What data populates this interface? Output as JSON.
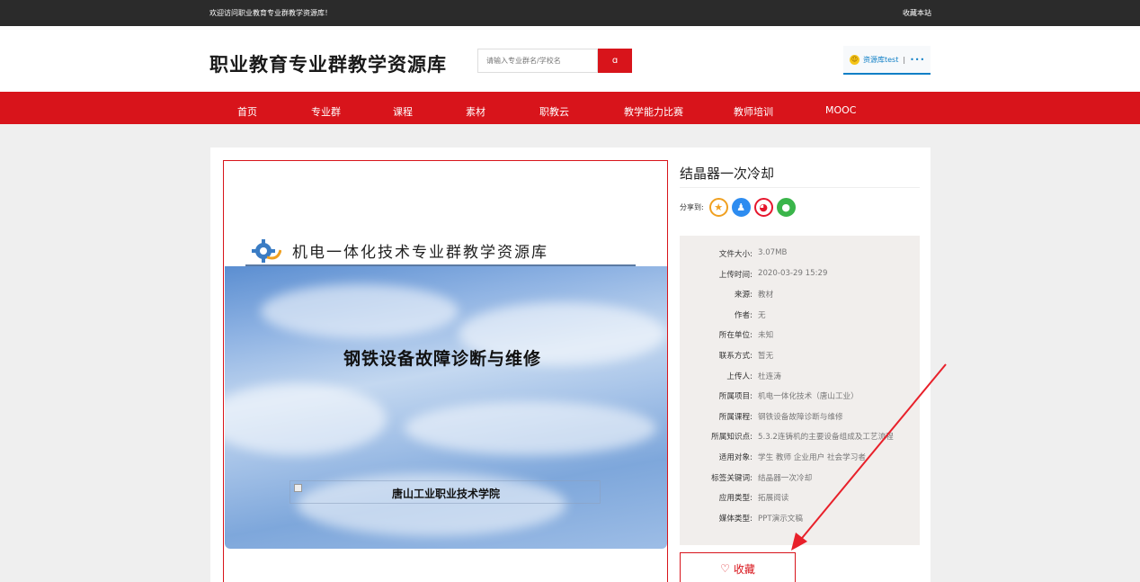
{
  "topbar": {
    "welcome": "欢迎访问职业教育专业群教学资源库！",
    "favorite": "收藏本站"
  },
  "header": {
    "logo": "职业教育专业群教学资源库",
    "search_placeholder": "请输入专业群名/学校名",
    "search_icon": "search-icon",
    "user_name": "资源库test",
    "user_sep": "|",
    "user_more": "•••"
  },
  "nav": {
    "items": [
      "首页",
      "专业群",
      "课程",
      "素材",
      "职教云",
      "教学能力比赛",
      "教师培训",
      "MOOC"
    ]
  },
  "preview": {
    "slide_title": "机电一体化技术专业群教学资源库",
    "slide_main": "钢铁设备故障诊断与维修",
    "slide_footer": "唐山工业职业技术学院"
  },
  "resource": {
    "title": "结晶器一次冷却",
    "share_label": "分享到:",
    "share_icons": [
      "star-icon",
      "qq-icon",
      "weibo-icon",
      "wechat-icon"
    ],
    "info": [
      {
        "label": "文件大小:",
        "value": "3.07MB"
      },
      {
        "label": "上传时间:",
        "value": "2020-03-29 15:29"
      },
      {
        "label": "来源:",
        "value": "教材"
      },
      {
        "label": "作者:",
        "value": "无"
      },
      {
        "label": "所在单位:",
        "value": "未知"
      },
      {
        "label": "联系方式:",
        "value": "暂无"
      },
      {
        "label": "上传人:",
        "value": "杜连涛"
      },
      {
        "label": "所属项目:",
        "value": "机电一体化技术（唐山工业）"
      },
      {
        "label": "所属课程:",
        "value": "钢铁设备故障诊断与维修"
      },
      {
        "label": "所属知识点:",
        "value": "5.3.2连铸机的主要设备组成及工艺流程"
      },
      {
        "label": "适用对象:",
        "value": "学生 教师 企业用户 社会学习者"
      },
      {
        "label": "标签关键词:",
        "value": "结晶器一次冷却"
      },
      {
        "label": "应用类型:",
        "value": "拓展阅读"
      },
      {
        "label": "媒体类型:",
        "value": "PPT演示文稿"
      }
    ],
    "collect_label": "收藏"
  },
  "colors": {
    "brand_red": "#d8141b",
    "topbar": "#2b2b2b",
    "info_bg": "#f1eeec",
    "annotation_arrow": "#e8202a"
  }
}
